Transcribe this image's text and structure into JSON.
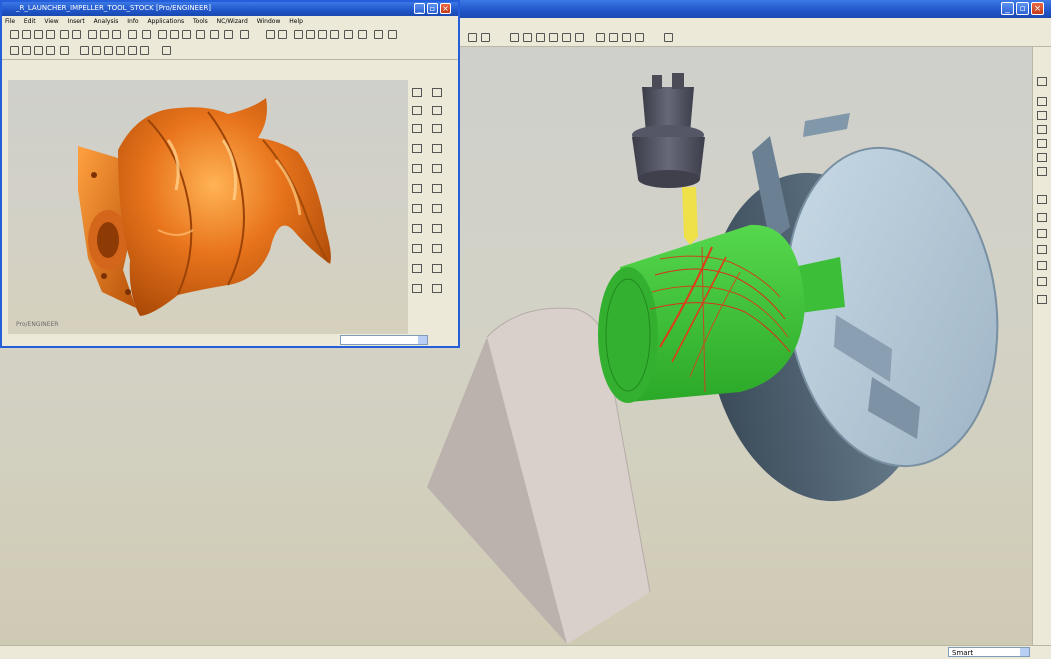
{
  "main_window": {
    "title": "",
    "filter_value": "Smart",
    "toolbar_icons": [
      "save-icon",
      "zoom-icon",
      "view-icon",
      "tool-icon"
    ],
    "scene": {
      "objects": [
        "cutting-tool-holder",
        "ball-end-mill",
        "green-stock-workpiece",
        "toolpath",
        "three-jaw-chuck",
        "tailstock"
      ],
      "colors": {
        "stock": "#3fc63a",
        "toolpath": "#d9301c",
        "chuck": "#a9bfcf",
        "holder": "#4c4e5c",
        "tool": "#f2e24c",
        "tailstock": "#d8cfcb"
      }
    }
  },
  "inset_window": {
    "title": "_R_LAUNCHER_IMPELLER_TOOL_STOCK   [Pro/ENGINEER]",
    "menu": [
      "File",
      "Edit",
      "View",
      "Insert",
      "Analysis",
      "Info",
      "Applications",
      "Tools",
      "NC/Wizard",
      "Window",
      "Help"
    ],
    "watermark": "Pro/ENGINEER",
    "model": {
      "name": "impeller",
      "color": "#e8741c"
    }
  }
}
